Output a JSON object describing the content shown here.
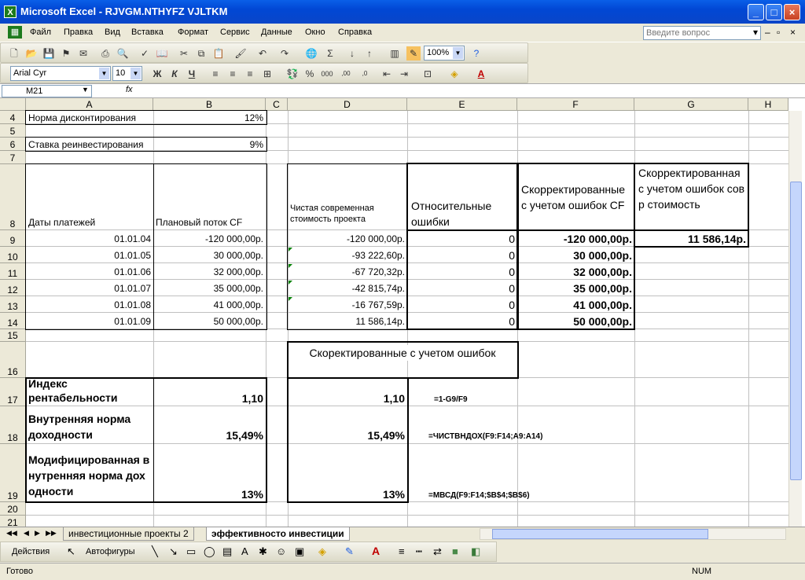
{
  "window": {
    "title": "Microsoft Excel - RJVGM.NTHYFZ VJLTKM",
    "app_icon_glyph": "X"
  },
  "menu": {
    "items": [
      "Файл",
      "Правка",
      "Вид",
      "Вставка",
      "Формат",
      "Сервис",
      "Данные",
      "Окно",
      "Справка"
    ],
    "ask_placeholder": "Введите вопрос"
  },
  "toolbar": {
    "zoom": "100%"
  },
  "format": {
    "font": "Arial Cyr",
    "size": "10"
  },
  "formula": {
    "cell_ref": "M21",
    "fx": "fx",
    "content": ""
  },
  "columns": [
    "A",
    "B",
    "C",
    "D",
    "E",
    "F",
    "G",
    "H"
  ],
  "rows": [
    "4",
    "5",
    "6",
    "7",
    "8",
    "9",
    "10",
    "11",
    "12",
    "13",
    "14",
    "15",
    "16",
    "17",
    "18",
    "19",
    "20",
    "21"
  ],
  "cells": {
    "A4": "Норма дисконтирования",
    "B4": "12%",
    "A6": "Ставка реинвестирования",
    "B6": "9%",
    "A8": "Даты платежей",
    "B8": "Плановый поток CF",
    "D8": "Чистая современная стоимость проекта",
    "E8": "Относительные ошибки",
    "F8": "Скорректированные с учетом ошибок CF",
    "G8": "Скорректированная с учетом ошибок совр стоимость",
    "A9": "01.01.04",
    "B9": "-120 000,00р.",
    "D9": "-120 000,00р.",
    "E9": "0",
    "F9": "-120 000,00р.",
    "G9": "11 586,14р.",
    "A10": "01.01.05",
    "B10": "30 000,00р.",
    "D10": "-93 222,60р.",
    "E10": "0",
    "F10": "30 000,00р.",
    "A11": "01.01.06",
    "B11": "32 000,00р.",
    "D11": "-67 720,32р.",
    "E11": "0",
    "F11": "32 000,00р.",
    "A12": "01.01.07",
    "B12": "35 000,00р.",
    "D12": "-42 815,74р.",
    "E12": "0",
    "F12": "35 000,00р.",
    "A13": "01.01.08",
    "B13": "41 000,00р.",
    "D13": "-16 767,59р.",
    "E13": "0",
    "F13": "41 000,00р.",
    "A14": "01.01.09",
    "B14": "50 000,00р.",
    "D14": "11 586,14р.",
    "E14": "0",
    "F14": "50 000,00р.",
    "D16": "Скоректированные с учетом ошибок",
    "A17": "Индекс рентабельности",
    "B17": "1,10",
    "D17": "1,10",
    "E17": "=1-G9/F9",
    "A18": "Внутренняя норма доходности",
    "B18": "15,49%",
    "D18": "15,49%",
    "E18": "=ЧИСТВНДОХ(F9:F14;A9:A14)",
    "A19": "Модифицированная внутренняя норма доходности",
    "B19": "13%",
    "D19": "13%",
    "E19": "=МВСД(F9:F14;$B$4;$B$6)"
  },
  "sheets": {
    "tab1": "инвестиционные проекты 2",
    "tab2": "эффективносто инвестиции"
  },
  "draw": {
    "actions": "Действия",
    "autoshapes": "Автофигуры"
  },
  "status": {
    "ready": "Готово",
    "num": "NUM"
  }
}
